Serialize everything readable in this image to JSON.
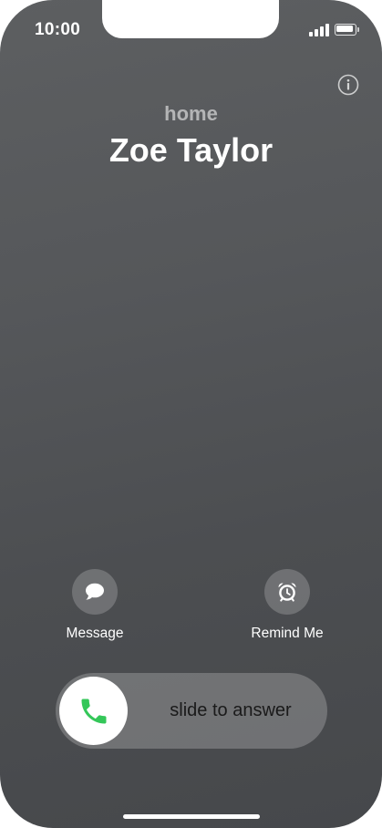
{
  "status_bar": {
    "time": "10:00"
  },
  "call": {
    "label": "home",
    "caller_name": "Zoe Taylor"
  },
  "actions": {
    "message_label": "Message",
    "remind_label": "Remind Me"
  },
  "slider": {
    "text": "slide to answer"
  },
  "colors": {
    "accept_green": "#34c759",
    "background": "#55575a"
  },
  "icons": {
    "info": "info-icon",
    "message": "message-bubble-icon",
    "remind": "alarm-clock-icon",
    "phone": "phone-icon"
  }
}
